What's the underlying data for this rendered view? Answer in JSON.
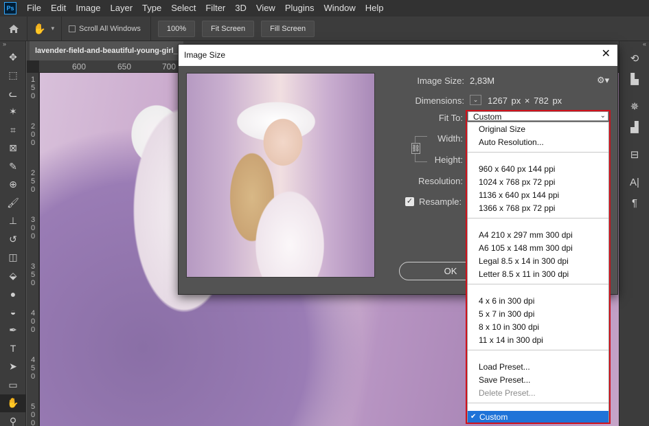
{
  "app": {
    "logo": "Ps",
    "menu": [
      "File",
      "Edit",
      "Image",
      "Layer",
      "Type",
      "Select",
      "Filter",
      "3D",
      "View",
      "Plugins",
      "Window",
      "Help"
    ]
  },
  "options_bar": {
    "scroll_all_windows": "Scroll All Windows",
    "zoom_value": "100%",
    "fit_screen": "Fit Screen",
    "fill_screen": "Fill Screen"
  },
  "document": {
    "tab_title": "lavender-field-and-beautiful-young-girl_",
    "ruler_h": [
      "600",
      "650",
      "700"
    ],
    "ruler_v": [
      [
        "1",
        "5",
        "0"
      ],
      [
        "2",
        "0",
        "0"
      ],
      [
        "2",
        "5",
        "0"
      ],
      [
        "3",
        "0",
        "0"
      ],
      [
        "3",
        "5",
        "0"
      ],
      [
        "4",
        "0",
        "0"
      ],
      [
        "4",
        "5",
        "0"
      ],
      [
        "5",
        "0",
        "0"
      ]
    ]
  },
  "toolbar": {
    "collapse": "»",
    "tools": [
      "move-icon",
      "marquee-icon",
      "lasso-icon",
      "magic-wand-icon",
      "crop-icon",
      "frame-icon",
      "eyedropper-icon",
      "healing-icon",
      "brush-icon",
      "stamp-icon",
      "history-brush-icon",
      "eraser-icon",
      "paint-bucket-icon",
      "blur-icon",
      "dodge-icon",
      "pen-icon",
      "type-icon",
      "path-select-icon",
      "rectangle-icon",
      "hand-icon",
      "zoom-icon"
    ],
    "glyphs": [
      "✥",
      "⬚",
      "ᓚ",
      "✶",
      "⌗",
      "⊠",
      "✎",
      "⊕",
      "🖌",
      "⊥",
      "↺",
      "◫",
      "⬙",
      "●",
      "◒",
      "✒",
      "T",
      "➤",
      "▭",
      "✋",
      "⚲"
    ],
    "active_index": 19
  },
  "right_panel": {
    "collapse": "«",
    "icons": [
      "history-icon",
      "swatches-icon",
      "adjustments-icon",
      "histogram-icon",
      "properties-icon",
      "character-icon",
      "paragraph-icon"
    ],
    "glyphs": [
      "⟲",
      "▙",
      "✵",
      "▟",
      "⊟",
      "A|",
      "¶"
    ]
  },
  "dialog": {
    "title": "Image Size",
    "close": "✕",
    "image_size_label": "Image Size:",
    "image_size_value": "2,83M",
    "dimensions_label": "Dimensions:",
    "dimensions_w": "1267",
    "dimensions_unit_w": "px",
    "dimensions_x": "×",
    "dimensions_h": "782",
    "dimensions_unit_h": "px",
    "fit_to_label": "Fit To:",
    "width_label": "Width:",
    "height_label": "Height:",
    "resolution_label": "Resolution:",
    "resample_label": "Resample:",
    "resample_checked": true,
    "ok_label": "OK"
  },
  "dropdown": {
    "selected": "Custom",
    "groups": [
      [
        "Original Size",
        "Auto Resolution..."
      ],
      [
        "960 x 640 px 144 ppi",
        "1024 x 768 px 72 ppi",
        "1136 x 640 px 144 ppi",
        "1366 x 768 px 72 ppi"
      ],
      [
        "A4 210 x 297 mm 300 dpi",
        "A6 105 x 148 mm 300 dpi",
        "Legal 8.5 x 14 in 300 dpi",
        "Letter 8.5 x 11 in 300 dpi"
      ],
      [
        "4 x 6 in 300 dpi",
        "5 x 7 in 300 dpi",
        "8 x 10 in 300 dpi",
        "11 x 14 in 300 dpi"
      ],
      [
        "Load Preset...",
        "Save Preset...",
        "Delete Preset..."
      ]
    ],
    "disabled": [
      "Delete Preset..."
    ],
    "highlight_color": "#1f73d8",
    "outline_color": "#d0101a"
  }
}
